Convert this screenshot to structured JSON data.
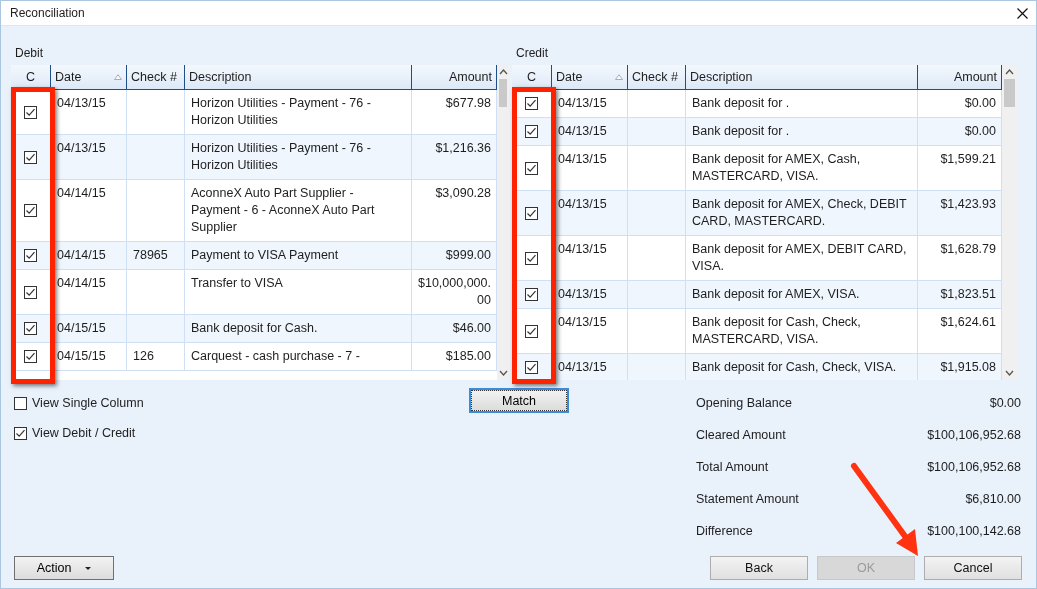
{
  "window": {
    "title": "Reconciliation"
  },
  "debit": {
    "label": "Debit",
    "columns": [
      {
        "label": "C",
        "annotated": true
      },
      {
        "label": "Date",
        "sorted": true
      },
      {
        "label": "Check #"
      },
      {
        "label": "Description"
      },
      {
        "label": "Amount"
      }
    ],
    "rows": [
      {
        "checked": true,
        "date": "04/13/15",
        "description": "Horizon Utilities - Payment - 76 - Horizon Utilities",
        "amount": "$677.98"
      },
      {
        "checked": true,
        "date": "04/13/15",
        "description": "Horizon Utilities - Payment - 76 - Horizon Utilities",
        "amount": "$1,216.36"
      },
      {
        "checked": true,
        "date": "04/14/15",
        "description": "AconneX Auto Part Supplier - Payment - 6 - AconneX Auto Part Supplier",
        "amount": "$3,090.28"
      },
      {
        "checked": true,
        "date": "04/14/15",
        "check": "78965",
        "description": "Payment to VISA Payment",
        "amount": "$999.00"
      },
      {
        "checked": true,
        "date": "04/14/15",
        "description": "Transfer to VISA",
        "amount": "$10,000,000.00"
      },
      {
        "checked": true,
        "date": "04/15/15",
        "description": "Bank deposit for Cash.",
        "amount": "$46.00"
      },
      {
        "checked": true,
        "date": "04/15/15",
        "check": "126",
        "description": "Carquest - cash purchase - 7 -",
        "amount": "$185.00"
      }
    ]
  },
  "credit": {
    "label": "Credit",
    "columns": [
      {
        "label": "C",
        "annotated": true
      },
      {
        "label": "Date",
        "sorted": true
      },
      {
        "label": "Check #"
      },
      {
        "label": "Description"
      },
      {
        "label": "Amount"
      }
    ],
    "rows": [
      {
        "checked": true,
        "date": "04/13/15",
        "description": "Bank deposit for .",
        "amount": "$0.00"
      },
      {
        "checked": true,
        "date": "04/13/15",
        "description": "Bank deposit for .",
        "amount": "$0.00"
      },
      {
        "checked": true,
        "date": "04/13/15",
        "description": "Bank deposit for AMEX, Cash, MASTERCARD, VISA.",
        "amount": "$1,599.21"
      },
      {
        "checked": true,
        "date": "04/13/15",
        "description": "Bank deposit for AMEX, Check, DEBIT CARD, MASTERCARD.",
        "amount": "$1,423.93"
      },
      {
        "checked": true,
        "date": "04/13/15",
        "description": "Bank deposit for AMEX, DEBIT CARD, VISA.",
        "amount": "$1,628.79"
      },
      {
        "checked": true,
        "date": "04/13/15",
        "description": "Bank deposit for AMEX, VISA.",
        "amount": "$1,823.51"
      },
      {
        "checked": true,
        "date": "04/13/15",
        "description": "Bank deposit for Cash, Check, MASTERCARD, VISA.",
        "amount": "$1,624.61"
      },
      {
        "checked": true,
        "date": "04/13/15",
        "description": "Bank deposit for Cash, Check, VISA.",
        "amount": "$1,915.08"
      }
    ]
  },
  "options": [
    {
      "label": "View Single Column",
      "checked": false
    },
    {
      "label": "View Debit / Credit",
      "checked": true
    }
  ],
  "match_button": {
    "label": "Match",
    "focused": true
  },
  "summary": [
    {
      "label": "Opening Balance",
      "value": "$0.00"
    },
    {
      "label": "Cleared Amount",
      "value": "$100,106,952.68"
    },
    {
      "label": "Total Amount",
      "value": "$100,106,952.68"
    },
    {
      "label": "Statement Amount",
      "value": "$6,810.00"
    },
    {
      "label": "Difference",
      "value": "$100,100,142.68"
    }
  ],
  "action_button": {
    "label": "Action"
  },
  "buttons": [
    {
      "label": "Back",
      "disabled": false
    },
    {
      "label": "OK",
      "disabled": true
    },
    {
      "label": "Cancel",
      "disabled": false
    }
  ],
  "annotation": {
    "kind": "arrow"
  }
}
